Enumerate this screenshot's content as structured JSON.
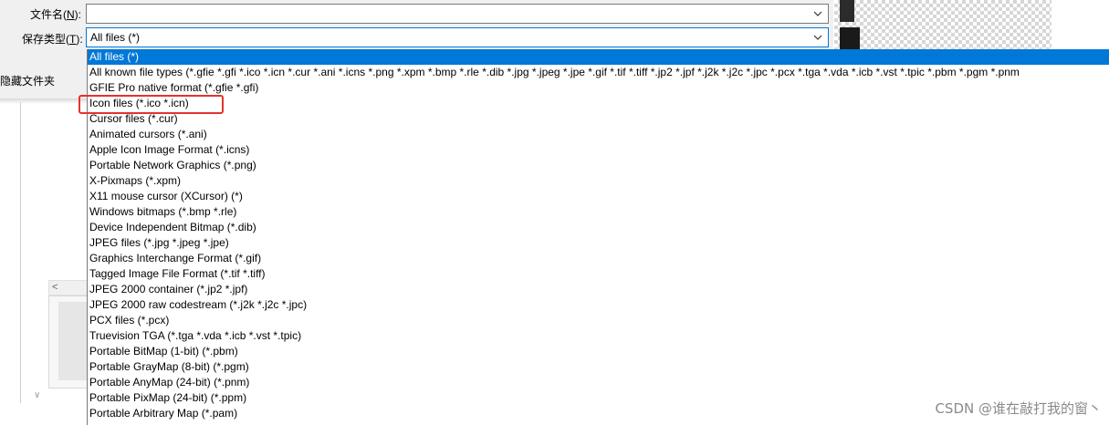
{
  "dialog": {
    "filename_label": "文件名(N):",
    "filename_label_pre": "文件名(",
    "filename_label_key": "N",
    "filename_label_post": "):",
    "filename_value": "",
    "filetype_label_pre": "保存类型(",
    "filetype_label_key": "T",
    "filetype_label_post": "):",
    "filetype_value": "All files (*)",
    "hide_folders": "隐藏文件夹"
  },
  "dropdown": {
    "selected_index": 0,
    "options": [
      "All files (*)",
      "All known file types (*.gfie *.gfi *.ico *.icn *.cur *.ani *.icns *.png *.xpm *.bmp *.rle *.dib *.jpg *.jpeg *.jpe *.gif *.tif *.tiff *.jp2 *.jpf *.j2k *.j2c *.jpc *.pcx *.tga *.vda *.icb *.vst *.tpic *.pbm *.pgm *.pnm",
      "GFIE Pro native format (*.gfie *.gfi)",
      "Icon files (*.ico *.icn)",
      "Cursor files (*.cur)",
      "Animated cursors (*.ani)",
      "Apple Icon Image Format (*.icns)",
      "Portable Network Graphics (*.png)",
      "X-Pixmaps (*.xpm)",
      "X11 mouse cursor (XCursor) (*)",
      "Windows bitmaps (*.bmp *.rle)",
      "Device Independent Bitmap (*.dib)",
      "JPEG files (*.jpg *.jpeg *.jpe)",
      "Graphics Interchange Format (*.gif)",
      "Tagged Image File Format (*.tif *.tiff)",
      "JPEG 2000 container (*.jp2 *.jpf)",
      "JPEG 2000 raw codestream (*.j2k *.j2c *.jpc)",
      "PCX files (*.pcx)",
      "Truevision TGA (*.tga *.vda *.icb *.vst *.tpic)",
      "Portable BitMap (1-bit) (*.pbm)",
      "Portable GrayMap (8-bit) (*.pgm)",
      "Portable AnyMap (24-bit) (*.pnm)",
      "Portable PixMap (24-bit) (*.ppm)",
      "Portable Arbitrary Map (*.pam)"
    ],
    "highlighted_option": "Icon files (*.ico *.icn)"
  },
  "watermark": "CSDN @谁在敲打我的窗丶",
  "colors": {
    "selection": "#0078d7",
    "highlight_box": "#e4332c",
    "dialog_bg": "#f0f0f0"
  },
  "icons": {
    "dropdown_chevron": "chevron-down-icon",
    "scroll_left": "chevron-left-icon",
    "scroll_down": "chevron-down-small-icon"
  }
}
